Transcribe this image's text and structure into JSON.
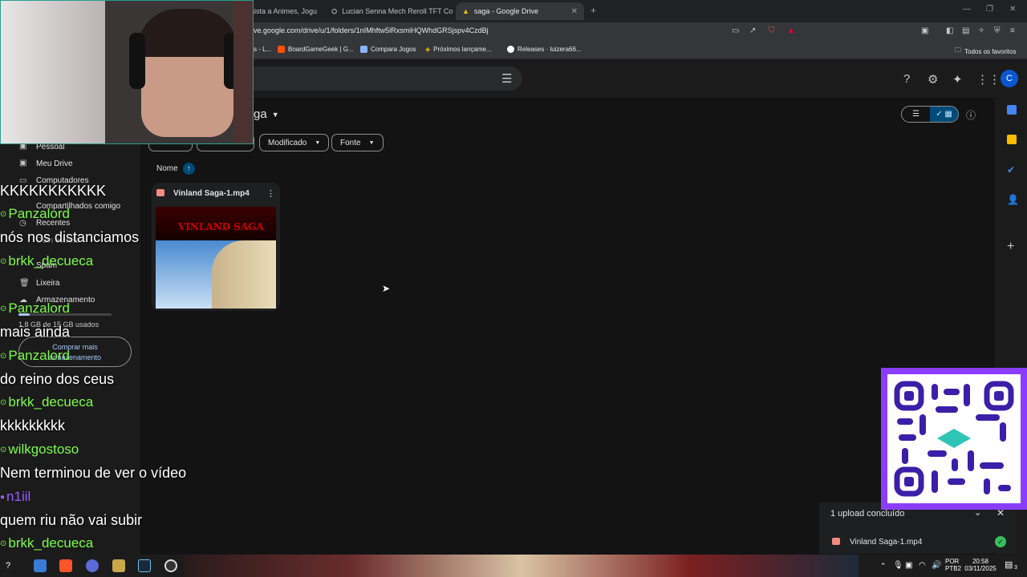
{
  "browser": {
    "tabs": [
      {
        "label": "ssista a Animes, Jogu",
        "active": false
      },
      {
        "label": "Lucian Senna Mech Reroll TFT Comp",
        "active": false
      },
      {
        "label": "saga - Google Drive",
        "active": true
      }
    ],
    "url": "ve.google.com/drive/u/1/folders/1nIMhftw5lRxsmiHQWhdGRSjspv4CzdBj",
    "bookmarks": [
      "s - L...",
      "BoardGameGeek | G...",
      "Compara Jogos",
      "Próximos lançame...",
      "Releases · luizera66..."
    ],
    "all_bookmarks": "Todos os favoritos"
  },
  "drive": {
    "avatar_letter": "C",
    "folder_title": "ga",
    "sidebar": {
      "items": [
        "Pessoal",
        "Meu Drive",
        "Computadores",
        "Compartilhados comigo",
        "Recentes",
        "Com estrela",
        "Spam",
        "Lixeira",
        "Armazenamento"
      ],
      "storage_used": "1,8 GB de 15 GB usados",
      "storage_fraction": 0.12,
      "buy_storage_line1": "Comprar mais",
      "buy_storage_line2": "armazenamento"
    },
    "filters": {
      "modified": "Modificado",
      "source": "Fonte"
    },
    "sort": {
      "label": "Nome"
    },
    "file": {
      "name": "Vinland Saga-1.mp4",
      "thumb_text": "VINLAND SAGA"
    },
    "upload": {
      "status": "1 upload concluído",
      "file": "Vinland Saga-1.mp4"
    }
  },
  "chat": [
    {
      "type": "msg",
      "text": "KKKKKKKKKKK"
    },
    {
      "type": "user",
      "name": "Panzalord",
      "color": "#7cfc4a"
    },
    {
      "type": "msg",
      "text": "nós nos distanciamos"
    },
    {
      "type": "user",
      "name": "brkk_decueca",
      "color": "#7cfc4a"
    },
    {
      "type": "user",
      "name": "Panzalord",
      "color": "#7cfc4a"
    },
    {
      "type": "msg",
      "text": "mais ainda"
    },
    {
      "type": "user",
      "name": "Panzalord",
      "color": "#7cfc4a"
    },
    {
      "type": "msg",
      "text": "do reino dos ceus"
    },
    {
      "type": "user",
      "name": "brkk_decueca",
      "color": "#7cfc4a"
    },
    {
      "type": "msg",
      "text": "kkkkkkkkk"
    },
    {
      "type": "user",
      "name": "wilkgostoso",
      "color": "#7cfc4a"
    },
    {
      "type": "msg",
      "text": "Nem terminou de ver o vídeo"
    },
    {
      "type": "user",
      "name": "n1iil",
      "color": "#9b5cff"
    },
    {
      "type": "msg",
      "text": "quem riu não vai subir"
    },
    {
      "type": "user",
      "name": "brkk_decueca",
      "color": "#7cfc4a"
    }
  ],
  "taskbar": {
    "lang1": "POR",
    "lang2": "PTB2",
    "time": "20:58",
    "date": "03/11/2025",
    "notifications": "3"
  },
  "colors": {
    "accent": "#a8c7fa",
    "qr_border": "#8b3dff"
  }
}
